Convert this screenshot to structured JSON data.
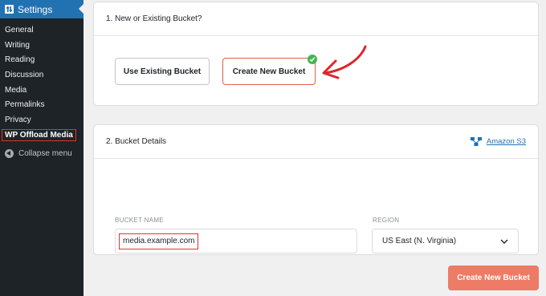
{
  "sidebar": {
    "header_label": "Settings",
    "items": [
      {
        "label": "General"
      },
      {
        "label": "Writing"
      },
      {
        "label": "Reading"
      },
      {
        "label": "Discussion"
      },
      {
        "label": "Media"
      },
      {
        "label": "Permalinks"
      },
      {
        "label": "Privacy"
      },
      {
        "label": "WP Offload Media"
      }
    ],
    "collapse_label": "Collapse menu"
  },
  "section1": {
    "title": "1. New or Existing Bucket?",
    "existing_label": "Use Existing Bucket",
    "new_label": "Create New Bucket",
    "selected": "Create New Bucket"
  },
  "section2": {
    "title": "2. Bucket Details",
    "provider_link": "Amazon S3",
    "bucket_label": "BUCKET NAME",
    "bucket_value": "media.example.com",
    "region_label": "REGION",
    "region_value": "US East (N. Virginia)"
  },
  "footer": {
    "submit_label": "Create New Bucket"
  },
  "colors": {
    "sidebar_bg": "#1d2327",
    "sidebar_active": "#2271b1",
    "accent": "#ed7b65",
    "highlight_border": "#d63638",
    "check": "#46b450",
    "link": "#2271b1"
  }
}
